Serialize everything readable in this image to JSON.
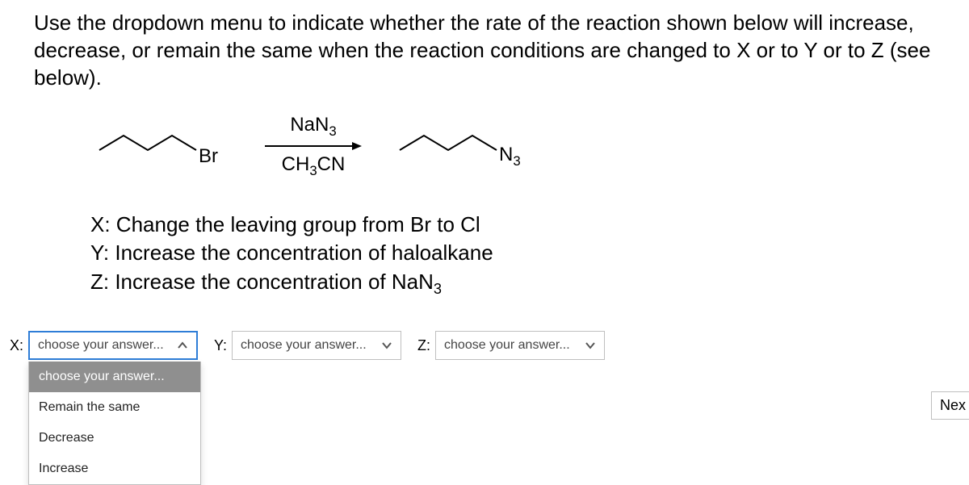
{
  "question": "Use the dropdown menu to indicate whether the rate of the reaction shown below will increase, decrease, or remain the same when the reaction conditions are changed to X or to Y or to Z (see below).",
  "reaction": {
    "reactant_label": "Br",
    "reagent_top_base": "NaN",
    "reagent_top_sub": "3",
    "solvent_base_a": "CH",
    "solvent_sub": "3",
    "solvent_base_b": "CN",
    "product_label_base": "N",
    "product_label_sub": "3"
  },
  "conditions": {
    "x": "X: Change the leaving group from Br to Cl",
    "y": "Y: Increase the concentration of haloalkane",
    "z_base_a": "Z: Increase the concentration of NaN",
    "z_sub": "3"
  },
  "answers": {
    "x_label": "X:",
    "y_label": "Y:",
    "z_label": "Z:",
    "placeholder": "choose your answer...",
    "options": {
      "placeholder": "choose your answer...",
      "opt1": "Remain the same",
      "opt2": "Decrease",
      "opt3": "Increase"
    }
  },
  "next_label": "Nex"
}
